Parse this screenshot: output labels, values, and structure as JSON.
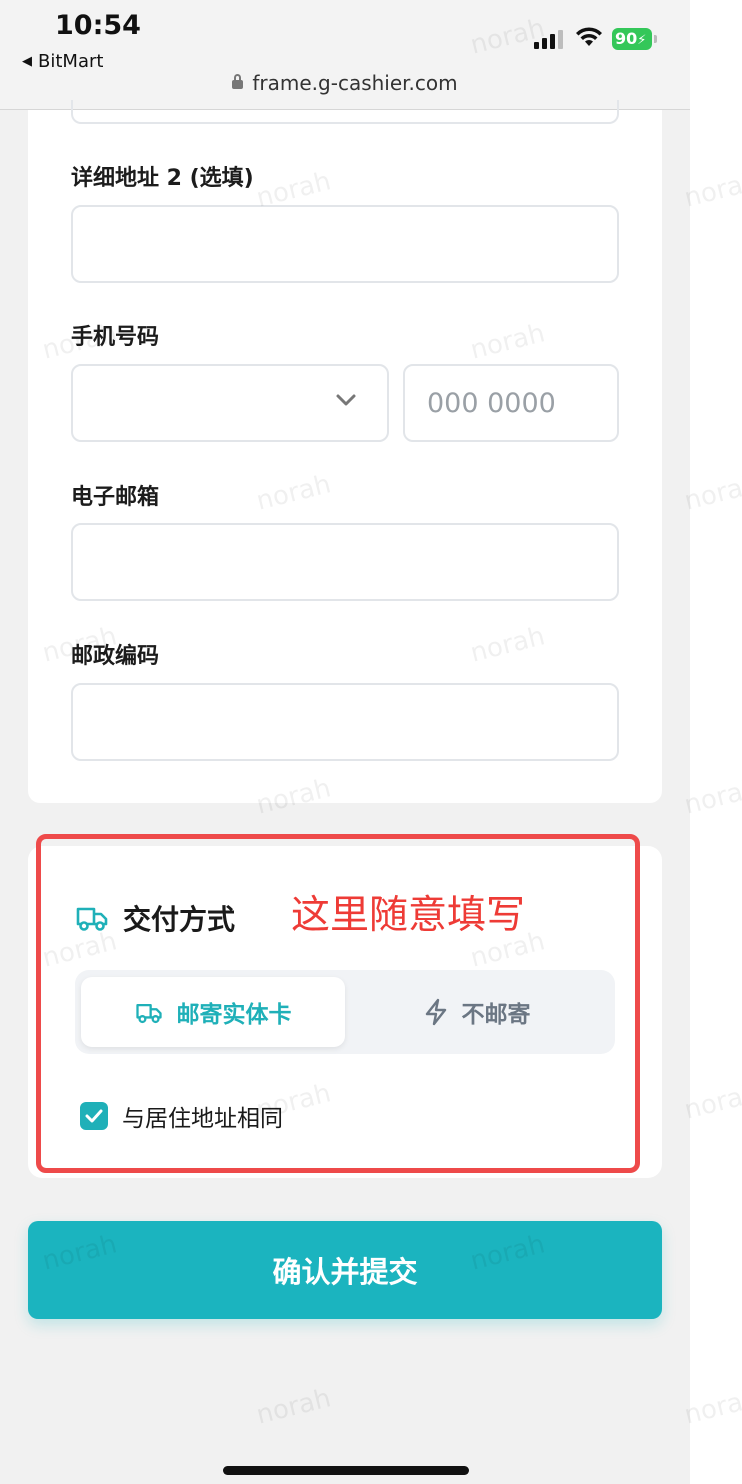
{
  "status_bar": {
    "time": "10:54",
    "back_app": "BitMart",
    "url": "frame.g-cashier.com",
    "battery_percent": "90"
  },
  "form": {
    "address2_label": "详细地址 2 (选填)",
    "address2_value": "",
    "phone_label": "手机号码",
    "phone_country_value": "",
    "phone_placeholder": "000 0000",
    "email_label": "电子邮箱",
    "email_value": "",
    "postal_label": "邮政编码",
    "postal_value": ""
  },
  "delivery": {
    "title": "交付方式",
    "annotation": "这里随意填写",
    "option_mail": "邮寄实体卡",
    "option_no_mail": "不邮寄",
    "selected_option": "邮寄实体卡",
    "same_address_label": "与居住地址相同",
    "same_address_checked": true
  },
  "submit_label": "确认并提交",
  "watermark_text": "norah",
  "colors": {
    "accent": "#1bb4bf",
    "annotation_red": "#ee4a4a",
    "battery_green": "#34c759"
  }
}
